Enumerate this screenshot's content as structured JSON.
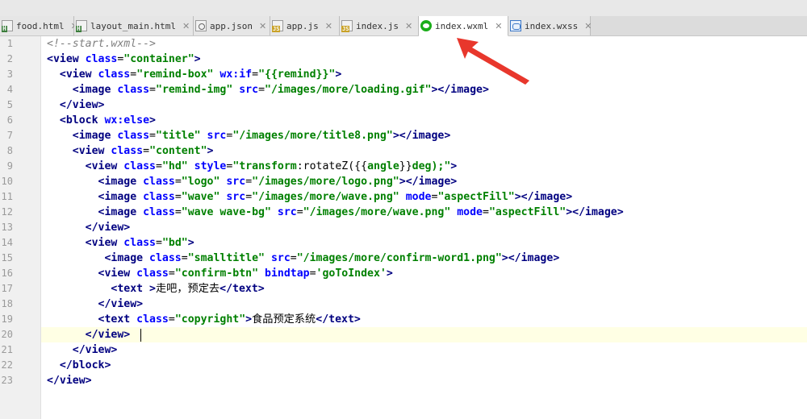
{
  "tabs": [
    {
      "name": "food.html",
      "icon": "html-file-icon",
      "active": false,
      "width": 92
    },
    {
      "name": "layout_main.html",
      "icon": "html-file-icon",
      "active": false,
      "width": 148
    },
    {
      "name": "app.json",
      "icon": "json-file-icon",
      "active": false,
      "width": 95
    },
    {
      "name": "app.js",
      "icon": "js-file-icon",
      "active": false,
      "width": 86
    },
    {
      "name": "index.js",
      "icon": "js-file-icon",
      "active": false,
      "width": 98
    },
    {
      "name": "index.wxml",
      "icon": "wechat-file-icon",
      "active": true,
      "width": 111
    },
    {
      "name": "index.wxss",
      "icon": "wxss-file-icon",
      "active": false,
      "width": 102
    }
  ],
  "close_glyph": "✕",
  "line_numbers": [
    "1",
    "2",
    "3",
    "4",
    "5",
    "6",
    "7",
    "8",
    "9",
    "10",
    "11",
    "12",
    "13",
    "14",
    "15",
    "16",
    "17",
    "18",
    "19",
    "20",
    "21",
    "22",
    "23"
  ],
  "code_lines": [
    [
      [
        "c",
        "<!--start.wxml-->"
      ]
    ],
    [
      [
        "t",
        "<view "
      ],
      [
        "a",
        "class"
      ],
      [
        "p",
        "="
      ],
      [
        "v",
        "\"container\""
      ],
      [
        "t",
        ">"
      ]
    ],
    [
      [
        "p",
        "  "
      ],
      [
        "t",
        "<view "
      ],
      [
        "a",
        "class"
      ],
      [
        "p",
        "="
      ],
      [
        "v",
        "\"remind-box\""
      ],
      [
        "p",
        " "
      ],
      [
        "a",
        "wx:if"
      ],
      [
        "p",
        "="
      ],
      [
        "v",
        "\"{{remind}}\""
      ],
      [
        "t",
        ">"
      ]
    ],
    [
      [
        "p",
        "    "
      ],
      [
        "t",
        "<image "
      ],
      [
        "a",
        "class"
      ],
      [
        "p",
        "="
      ],
      [
        "v",
        "\"remind-img\""
      ],
      [
        "p",
        " "
      ],
      [
        "a",
        "src"
      ],
      [
        "p",
        "="
      ],
      [
        "v",
        "\"/images/more/loading.gif\""
      ],
      [
        "t",
        "></image>"
      ]
    ],
    [
      [
        "p",
        "  "
      ],
      [
        "t",
        "</view>"
      ]
    ],
    [
      [
        "p",
        "  "
      ],
      [
        "t",
        "<block "
      ],
      [
        "a",
        "wx:else"
      ],
      [
        "t",
        ">"
      ]
    ],
    [
      [
        "p",
        "    "
      ],
      [
        "t",
        "<image "
      ],
      [
        "a",
        "class"
      ],
      [
        "p",
        "="
      ],
      [
        "v",
        "\"title\""
      ],
      [
        "p",
        " "
      ],
      [
        "a",
        "src"
      ],
      [
        "p",
        "="
      ],
      [
        "v",
        "\"/images/more/title8.png\""
      ],
      [
        "t",
        "></image>"
      ]
    ],
    [
      [
        "p",
        "    "
      ],
      [
        "t",
        "<view "
      ],
      [
        "a",
        "class"
      ],
      [
        "p",
        "="
      ],
      [
        "v",
        "\"content\""
      ],
      [
        "t",
        ">"
      ]
    ],
    [
      [
        "p",
        "      "
      ],
      [
        "t",
        "<view "
      ],
      [
        "a",
        "class"
      ],
      [
        "p",
        "="
      ],
      [
        "v",
        "\"hd\""
      ],
      [
        "p",
        " "
      ],
      [
        "a",
        "style"
      ],
      [
        "p",
        "="
      ],
      [
        "v",
        "\"transform"
      ],
      [
        "p",
        ":rotateZ({{"
      ],
      [
        "v",
        "angle"
      ],
      [
        "p",
        "}}"
      ],
      [
        "v",
        "deg);\""
      ],
      [
        "t",
        ">"
      ]
    ],
    [
      [
        "p",
        "        "
      ],
      [
        "t",
        "<image "
      ],
      [
        "a",
        "class"
      ],
      [
        "p",
        "="
      ],
      [
        "v",
        "\"logo\""
      ],
      [
        "p",
        " "
      ],
      [
        "a",
        "src"
      ],
      [
        "p",
        "="
      ],
      [
        "v",
        "\"/images/more/logo.png\""
      ],
      [
        "t",
        "></image>"
      ]
    ],
    [
      [
        "p",
        "        "
      ],
      [
        "t",
        "<image "
      ],
      [
        "a",
        "class"
      ],
      [
        "p",
        "="
      ],
      [
        "v",
        "\"wave\""
      ],
      [
        "p",
        " "
      ],
      [
        "a",
        "src"
      ],
      [
        "p",
        "="
      ],
      [
        "v",
        "\"/images/more/wave.png\""
      ],
      [
        "p",
        " "
      ],
      [
        "a",
        "mode"
      ],
      [
        "p",
        "="
      ],
      [
        "v",
        "\"aspectFill\""
      ],
      [
        "t",
        "></image>"
      ]
    ],
    [
      [
        "p",
        "        "
      ],
      [
        "t",
        "<image "
      ],
      [
        "a",
        "class"
      ],
      [
        "p",
        "="
      ],
      [
        "v",
        "\"wave wave-bg\""
      ],
      [
        "p",
        " "
      ],
      [
        "a",
        "src"
      ],
      [
        "p",
        "="
      ],
      [
        "v",
        "\"/images/more/wave.png\""
      ],
      [
        "p",
        " "
      ],
      [
        "a",
        "mode"
      ],
      [
        "p",
        "="
      ],
      [
        "v",
        "\"aspectFill\""
      ],
      [
        "t",
        "></image>"
      ]
    ],
    [
      [
        "p",
        "      "
      ],
      [
        "t",
        "</view>"
      ]
    ],
    [
      [
        "p",
        "      "
      ],
      [
        "t",
        "<view "
      ],
      [
        "a",
        "class"
      ],
      [
        "p",
        "="
      ],
      [
        "v",
        "\"bd\""
      ],
      [
        "t",
        ">"
      ]
    ],
    [
      [
        "p",
        "         "
      ],
      [
        "t",
        "<image "
      ],
      [
        "a",
        "class"
      ],
      [
        "p",
        "="
      ],
      [
        "v",
        "\"smalltitle\""
      ],
      [
        "p",
        " "
      ],
      [
        "a",
        "src"
      ],
      [
        "p",
        "="
      ],
      [
        "v",
        "\"/images/more/confirm-word1.png\""
      ],
      [
        "t",
        "></image>"
      ]
    ],
    [
      [
        "p",
        "        "
      ],
      [
        "t",
        "<view "
      ],
      [
        "a",
        "class"
      ],
      [
        "p",
        "="
      ],
      [
        "v",
        "\"confirm-btn\""
      ],
      [
        "p",
        " "
      ],
      [
        "a",
        "bindtap"
      ],
      [
        "p",
        "="
      ],
      [
        "v",
        "'goToIndex'"
      ],
      [
        "t",
        ">"
      ]
    ],
    [
      [
        "p",
        "          "
      ],
      [
        "t",
        "<text "
      ],
      [
        "t",
        ">"
      ],
      [
        "p",
        "走吧，预定去"
      ],
      [
        "t",
        "</text>"
      ]
    ],
    [
      [
        "p",
        "        "
      ],
      [
        "t",
        "</view>"
      ]
    ],
    [
      [
        "p",
        "        "
      ],
      [
        "t",
        "<text "
      ],
      [
        "a",
        "class"
      ],
      [
        "p",
        "="
      ],
      [
        "v",
        "\"copyright\""
      ],
      [
        "t",
        ">"
      ],
      [
        "p",
        "食品预定系统"
      ],
      [
        "t",
        "</text>"
      ]
    ],
    [
      [
        "p",
        "      "
      ],
      [
        "t",
        "</view>"
      ]
    ],
    [
      [
        "p",
        "    "
      ],
      [
        "t",
        "</view>"
      ]
    ],
    [
      [
        "p",
        "  "
      ],
      [
        "t",
        "</block>"
      ]
    ],
    [
      [
        "t",
        "</view>"
      ]
    ]
  ],
  "current_line": 20,
  "colors": {
    "annotation_arrow": "#e8372c",
    "tag": "#000080",
    "attr": "#0000ff",
    "value": "#008000",
    "comment": "#808080"
  }
}
